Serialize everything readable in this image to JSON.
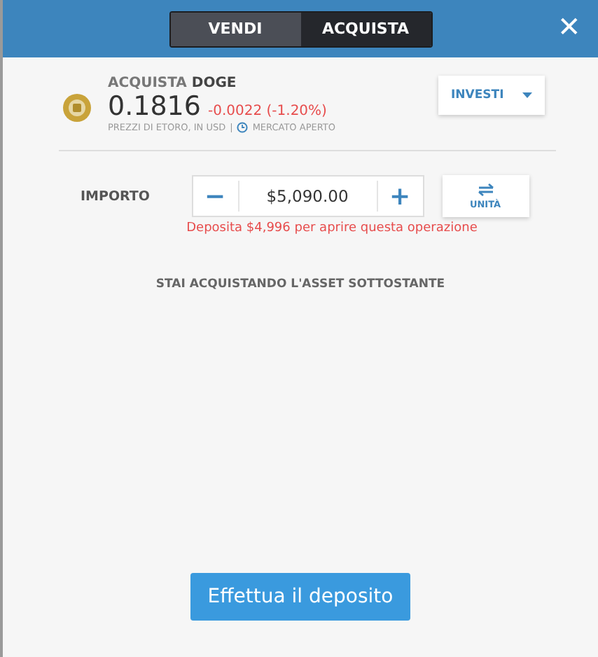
{
  "tabs": [
    {
      "label": "VENDI",
      "selected": false
    },
    {
      "label": "ACQUISTA",
      "selected": true
    }
  ],
  "close": "✕",
  "asset": {
    "action": "ACQUISTA",
    "symbol": "DOGE",
    "price": "0.1816",
    "change": "-0.0022 (-1.20%)",
    "source": "PREZZI DI ETORO, IN USD",
    "separator": "|",
    "market": "MERCATO APERTO"
  },
  "invest_button": "INVESTI",
  "amount": {
    "label": "IMPORTO",
    "minus": "−",
    "value": "$5,090.00",
    "plus": "+",
    "units_button": "UNITÀ"
  },
  "warning": "Deposita $4,996 per aprire questa operazione",
  "note": "STAI ACQUISTANDO L'ASSET SOTTOSTANTE",
  "deposit_button": "Effettua il deposito"
}
